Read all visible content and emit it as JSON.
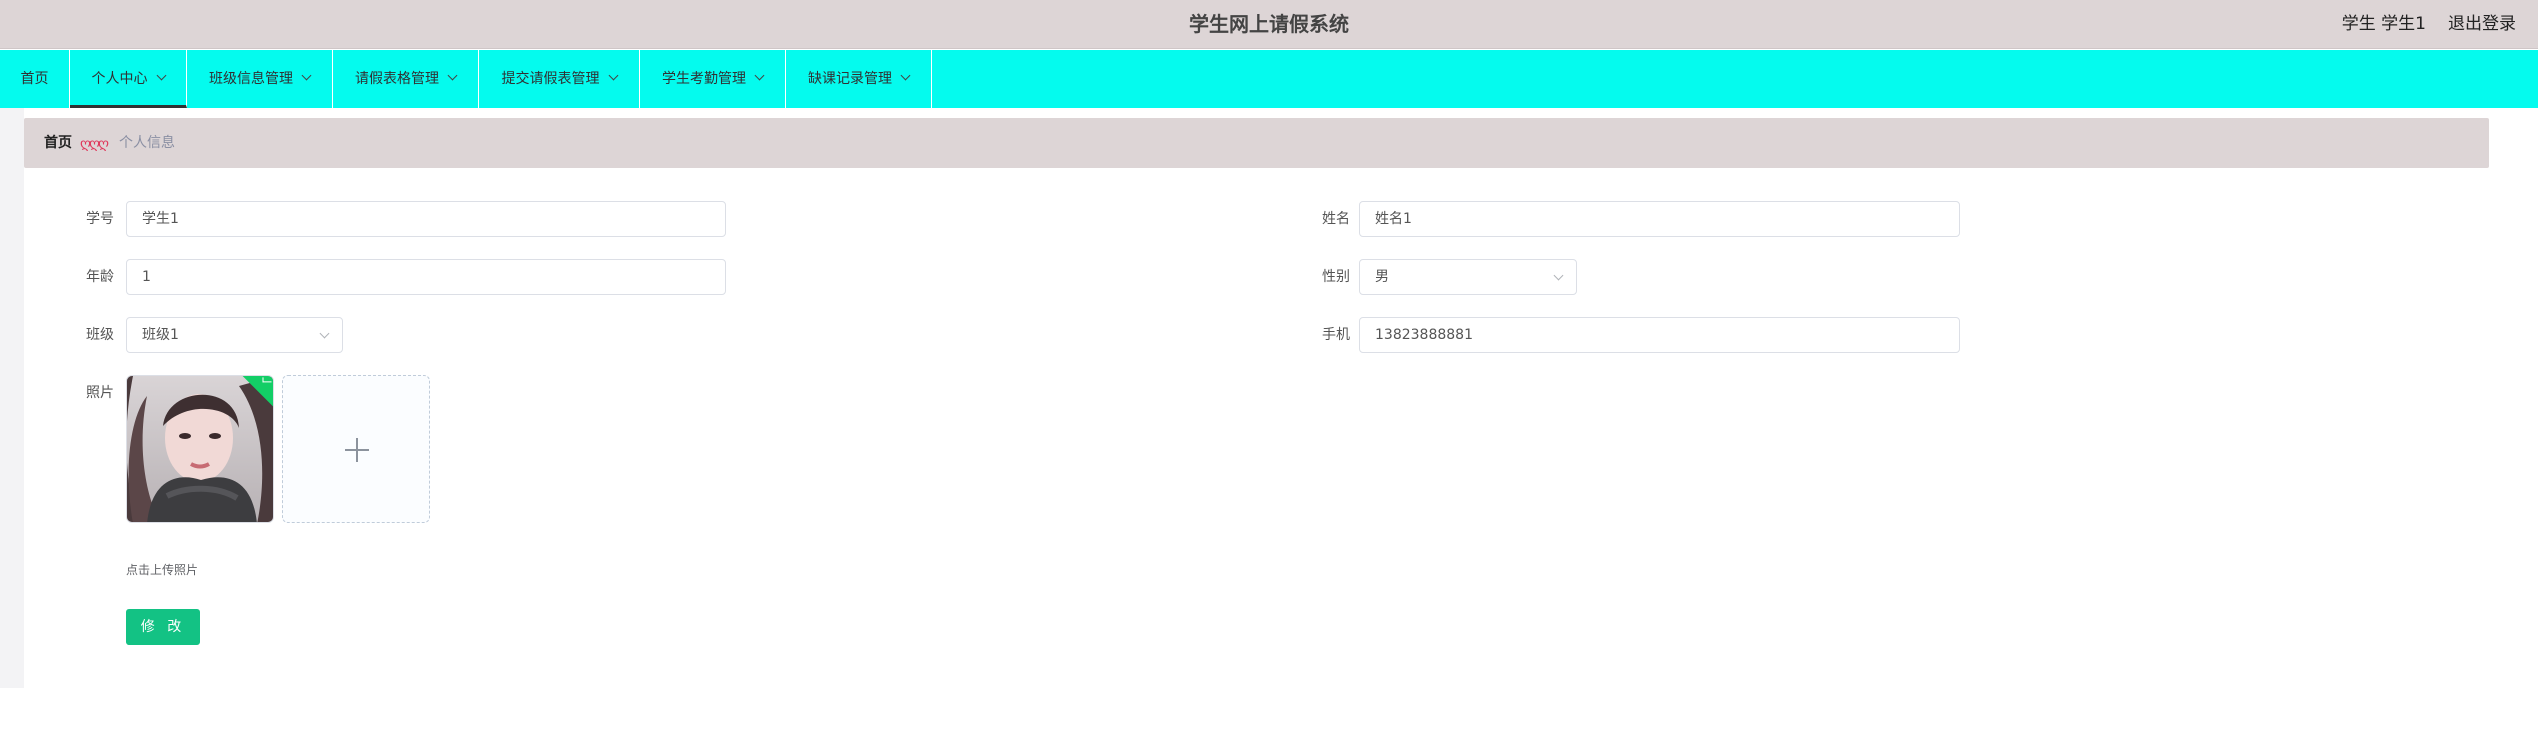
{
  "header": {
    "title": "学生网上请假系统",
    "user": "学生 学生1",
    "logout": "退出登录"
  },
  "nav": {
    "items": [
      {
        "label": "首页",
        "has_dropdown": false
      },
      {
        "label": "个人中心",
        "has_dropdown": true,
        "active": true
      },
      {
        "label": "班级信息管理",
        "has_dropdown": true
      },
      {
        "label": "请假表格管理",
        "has_dropdown": true
      },
      {
        "label": "提交请假表管理",
        "has_dropdown": true
      },
      {
        "label": "学生考勤管理",
        "has_dropdown": true
      },
      {
        "label": "缺课记录管理",
        "has_dropdown": true
      }
    ]
  },
  "breadcrumb": {
    "home": "首页",
    "separator": "ღღღ",
    "current": "个人信息"
  },
  "form": {
    "student_id": {
      "label": "学号",
      "value": "学生1"
    },
    "name": {
      "label": "姓名",
      "value": "姓名1"
    },
    "age": {
      "label": "年龄",
      "value": "1"
    },
    "gender": {
      "label": "性别",
      "value": "男"
    },
    "class": {
      "label": "班级",
      "value": "班级1"
    },
    "phone": {
      "label": "手机",
      "value": "13823888881"
    },
    "photo": {
      "label": "照片",
      "upload_tip": "点击上传照片"
    },
    "submit": "修 改"
  },
  "colors": {
    "nav_bg": "#04fbee",
    "header_bg": "#ddd5d6",
    "primary_button": "#13c284",
    "breadcrumb_separator": "#e0365a"
  },
  "icons": [
    "chevron-down-icon",
    "plus-icon",
    "check-icon"
  ]
}
